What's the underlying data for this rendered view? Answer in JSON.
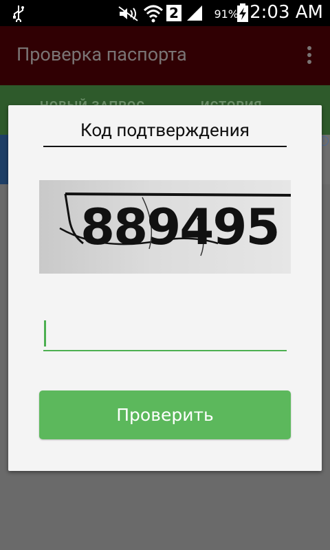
{
  "status_bar": {
    "battery_percent": "91%",
    "time": "2:03 AM",
    "sim_slot": "2",
    "icons": [
      "usb-icon",
      "mute-icon",
      "wifi-icon",
      "sim-2-icon",
      "signal-icon",
      "battery-charging-icon"
    ]
  },
  "app_bar": {
    "title": "Проверка паспорта",
    "overflow_menu_icon": "more-vert-icon"
  },
  "tabs": [
    {
      "label": "НОВЫЙ ЗАПРОС"
    },
    {
      "label": "ИСТОРИЯ"
    }
  ],
  "dialog": {
    "title": "Код подтверждения",
    "captcha_text": "889495",
    "input": {
      "value": "",
      "placeholder": ""
    },
    "submit_label": "Проверить"
  },
  "colors": {
    "app_bar_bg": "#300003",
    "tab_bar_bg": "#2e5a2b",
    "accent_green": "#5cb85c",
    "dialog_bg": "#f4f4f4"
  }
}
